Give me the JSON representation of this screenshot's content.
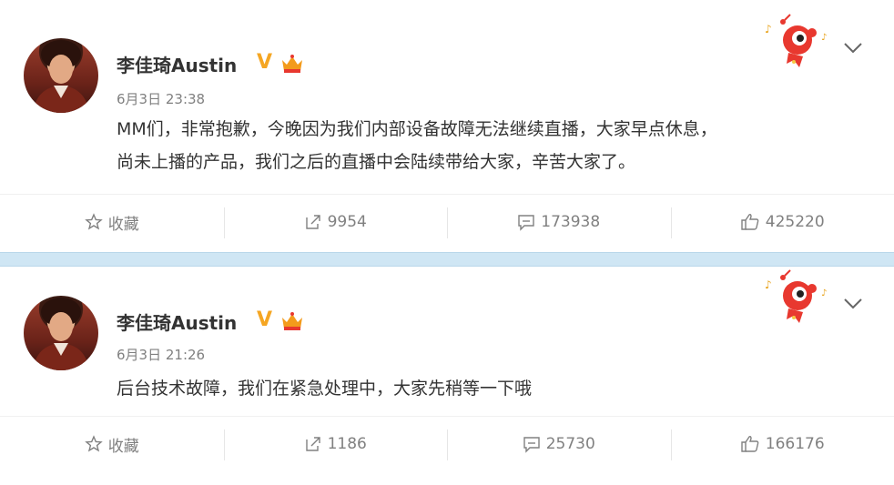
{
  "posts": [
    {
      "author": "李佳琦Austin",
      "verified_mark": "V",
      "time": "6月3日 23:38",
      "content_line1": "MM们，非常抱歉，今晚因为我们内部设备故障无法继续直播，大家早点休息，",
      "content_line2": "尚未上播的产品，我们之后的直播中会陆续带给大家，辛苦大家了。",
      "actions": {
        "favorite_label": "收藏",
        "repost_count": "9954",
        "comment_count": "173938",
        "like_count": "425220"
      }
    },
    {
      "author": "李佳琦Austin",
      "verified_mark": "V",
      "time": "6月3日 21:26",
      "content_line1": "后台技术故障，我们在紧急处理中，大家先稍等一下哦",
      "actions": {
        "favorite_label": "收藏",
        "repost_count": "1186",
        "comment_count": "25730",
        "like_count": "166176"
      }
    }
  ],
  "colors": {
    "verified": "#f5a623",
    "separator": "#cfe6f4",
    "mascot": "#e8382f"
  },
  "icons": {
    "favorite": "star-icon",
    "repost": "repost-icon",
    "comment": "comment-icon",
    "like": "thumbs-up-icon",
    "menu": "chevron-down-icon"
  }
}
